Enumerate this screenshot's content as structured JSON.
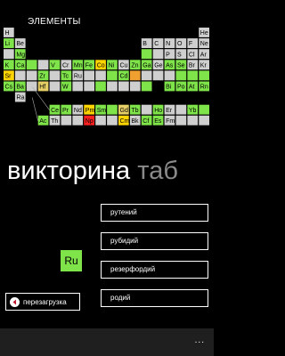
{
  "header": {
    "title": "ЭЛЕМЕНТЫ"
  },
  "colors": {
    "nonmetal": "#7fe34a",
    "metal": "#cfcfcf",
    "highlight": "#ffd400",
    "alkali": "#e6cf66",
    "selected": "#ff2020",
    "gold": "#f0a030"
  },
  "table": [
    {
      "sym": "H",
      "row": 0,
      "col": 0,
      "cat": "metal"
    },
    {
      "sym": "He",
      "row": 0,
      "col": 17,
      "cat": "metal"
    },
    {
      "sym": "Li",
      "row": 1,
      "col": 0,
      "cat": "nonmetal"
    },
    {
      "sym": "Be",
      "row": 1,
      "col": 1,
      "cat": "metal"
    },
    {
      "sym": "B",
      "row": 1,
      "col": 12,
      "cat": "metal"
    },
    {
      "sym": "C",
      "row": 1,
      "col": 13,
      "cat": "metal"
    },
    {
      "sym": "N",
      "row": 1,
      "col": 14,
      "cat": "metal"
    },
    {
      "sym": "O",
      "row": 1,
      "col": 15,
      "cat": "metal"
    },
    {
      "sym": "F",
      "row": 1,
      "col": 16,
      "cat": "metal"
    },
    {
      "sym": "Ne",
      "row": 1,
      "col": 17,
      "cat": "metal"
    },
    {
      "sym": "Mg",
      "row": 2,
      "col": 1,
      "cat": "nonmetal"
    },
    {
      "sym": "",
      "row": 2,
      "col": 0,
      "cat": "metal"
    },
    {
      "sym": "",
      "row": 2,
      "col": 12,
      "cat": "nonmetal"
    },
    {
      "sym": "",
      "row": 2,
      "col": 13,
      "cat": "metal"
    },
    {
      "sym": "P",
      "row": 2,
      "col": 14,
      "cat": "metal"
    },
    {
      "sym": "S",
      "row": 2,
      "col": 15,
      "cat": "metal"
    },
    {
      "sym": "Cl",
      "row": 2,
      "col": 16,
      "cat": "metal"
    },
    {
      "sym": "Ar",
      "row": 2,
      "col": 17,
      "cat": "metal"
    },
    {
      "sym": "K",
      "row": 3,
      "col": 0,
      "cat": "nonmetal"
    },
    {
      "sym": "Ca",
      "row": 3,
      "col": 1,
      "cat": "nonmetal"
    },
    {
      "sym": "",
      "row": 3,
      "col": 2,
      "cat": "nonmetal"
    },
    {
      "sym": "",
      "row": 3,
      "col": 3,
      "cat": "metal"
    },
    {
      "sym": "V",
      "row": 3,
      "col": 4,
      "cat": "nonmetal"
    },
    {
      "sym": "Cr",
      "row": 3,
      "col": 5,
      "cat": "metal"
    },
    {
      "sym": "Mn",
      "row": 3,
      "col": 6,
      "cat": "nonmetal"
    },
    {
      "sym": "Fe",
      "row": 3,
      "col": 7,
      "cat": "nonmetal"
    },
    {
      "sym": "Co",
      "row": 3,
      "col": 8,
      "cat": "highlight"
    },
    {
      "sym": "Ni",
      "row": 3,
      "col": 9,
      "cat": "nonmetal"
    },
    {
      "sym": "Cu",
      "row": 3,
      "col": 10,
      "cat": "metal"
    },
    {
      "sym": "Zn",
      "row": 3,
      "col": 11,
      "cat": "nonmetal"
    },
    {
      "sym": "Ga",
      "row": 3,
      "col": 12,
      "cat": "nonmetal"
    },
    {
      "sym": "Ge",
      "row": 3,
      "col": 13,
      "cat": "metal"
    },
    {
      "sym": "As",
      "row": 3,
      "col": 14,
      "cat": "nonmetal"
    },
    {
      "sym": "Se",
      "row": 3,
      "col": 15,
      "cat": "nonmetal"
    },
    {
      "sym": "Br",
      "row": 3,
      "col": 16,
      "cat": "metal"
    },
    {
      "sym": "Kr",
      "row": 3,
      "col": 17,
      "cat": "metal"
    },
    {
      "sym": "",
      "row": 4,
      "col": 0,
      "cat": "metal"
    },
    {
      "sym": "",
      "row": 4,
      "col": 1,
      "cat": "metal"
    },
    {
      "sym": "",
      "row": 4,
      "col": 2,
      "cat": "metal"
    },
    {
      "sym": "Zr",
      "row": 4,
      "col": 3,
      "cat": "nonmetal"
    },
    {
      "sym": "",
      "row": 4,
      "col": 4,
      "cat": "metal"
    },
    {
      "sym": "Tc",
      "row": 4,
      "col": 5,
      "cat": "nonmetal"
    },
    {
      "sym": "Ru",
      "row": 4,
      "col": 6,
      "cat": "metal"
    },
    {
      "sym": "",
      "row": 4,
      "col": 7,
      "cat": "metal"
    },
    {
      "sym": "",
      "row": 4,
      "col": 8,
      "cat": "metal"
    },
    {
      "sym": "",
      "row": 4,
      "col": 9,
      "cat": "nonmetal"
    },
    {
      "sym": "Cd",
      "row": 4,
      "col": 10,
      "cat": "nonmetal"
    },
    {
      "sym": "",
      "row": 4,
      "col": 11,
      "cat": "gold"
    },
    {
      "sym": "",
      "row": 4,
      "col": 12,
      "cat": "metal"
    },
    {
      "sym": "",
      "row": 4,
      "col": 13,
      "cat": "metal"
    },
    {
      "sym": "",
      "row": 4,
      "col": 14,
      "cat": "metal"
    },
    {
      "sym": "",
      "row": 4,
      "col": 15,
      "cat": "nonmetal"
    },
    {
      "sym": "",
      "row": 4,
      "col": 16,
      "cat": "nonmetal"
    },
    {
      "sym": "",
      "row": 4,
      "col": 17,
      "cat": "nonmetal"
    },
    {
      "sym": "Cs",
      "row": 5,
      "col": 0,
      "cat": "nonmetal"
    },
    {
      "sym": "Ba",
      "row": 5,
      "col": 1,
      "cat": "nonmetal"
    },
    {
      "sym": "",
      "row": 5,
      "col": 2,
      "cat": "metal"
    },
    {
      "sym": "Hf",
      "row": 5,
      "col": 3,
      "cat": "alkali"
    },
    {
      "sym": "",
      "row": 5,
      "col": 4,
      "cat": "metal"
    },
    {
      "sym": "W",
      "row": 5,
      "col": 5,
      "cat": "nonmetal"
    },
    {
      "sym": "",
      "row": 5,
      "col": 6,
      "cat": "metal"
    },
    {
      "sym": "",
      "row": 5,
      "col": 7,
      "cat": "metal"
    },
    {
      "sym": "",
      "row": 5,
      "col": 8,
      "cat": "nonmetal"
    },
    {
      "sym": "",
      "row": 5,
      "col": 9,
      "cat": "metal"
    },
    {
      "sym": "",
      "row": 5,
      "col": 10,
      "cat": "metal"
    },
    {
      "sym": "",
      "row": 5,
      "col": 11,
      "cat": "metal"
    },
    {
      "sym": "",
      "row": 5,
      "col": 12,
      "cat": "nonmetal"
    },
    {
      "sym": "Bi",
      "row": 5,
      "col": 14,
      "cat": "nonmetal"
    },
    {
      "sym": "Po",
      "row": 5,
      "col": 15,
      "cat": "nonmetal"
    },
    {
      "sym": "At",
      "row": 5,
      "col": 16,
      "cat": "nonmetal"
    },
    {
      "sym": "Rn",
      "row": 5,
      "col": 17,
      "cat": "nonmetal"
    },
    {
      "sym": "Ra",
      "row": 6,
      "col": 1,
      "cat": "metal"
    },
    {
      "sym": "Sr",
      "row": 4,
      "col": 0,
      "cat": "highlight"
    },
    {
      "sym": "Ce",
      "row": 8,
      "col": 4,
      "cat": "nonmetal"
    },
    {
      "sym": "Pr",
      "row": 8,
      "col": 5,
      "cat": "nonmetal"
    },
    {
      "sym": "Nd",
      "row": 8,
      "col": 6,
      "cat": "metal"
    },
    {
      "sym": "Pm",
      "row": 8,
      "col": 7,
      "cat": "highlight"
    },
    {
      "sym": "Sm",
      "row": 8,
      "col": 8,
      "cat": "nonmetal"
    },
    {
      "sym": "",
      "row": 8,
      "col": 9,
      "cat": "nonmetal"
    },
    {
      "sym": "Gd",
      "row": 8,
      "col": 10,
      "cat": "alkali"
    },
    {
      "sym": "Tb",
      "row": 8,
      "col": 11,
      "cat": "nonmetal"
    },
    {
      "sym": "",
      "row": 8,
      "col": 12,
      "cat": "metal"
    },
    {
      "sym": "Ho",
      "row": 8,
      "col": 13,
      "cat": "nonmetal"
    },
    {
      "sym": "Er",
      "row": 8,
      "col": 14,
      "cat": "metal"
    },
    {
      "sym": "",
      "row": 8,
      "col": 15,
      "cat": "metal"
    },
    {
      "sym": "Yb",
      "row": 8,
      "col": 16,
      "cat": "nonmetal"
    },
    {
      "sym": "",
      "row": 8,
      "col": 17,
      "cat": "nonmetal"
    },
    {
      "sym": "Ac",
      "row": 9,
      "col": 3,
      "cat": "nonmetal"
    },
    {
      "sym": "Th",
      "row": 9,
      "col": 4,
      "cat": "metal"
    },
    {
      "sym": "",
      "row": 9,
      "col": 5,
      "cat": "metal"
    },
    {
      "sym": "",
      "row": 9,
      "col": 6,
      "cat": "metal"
    },
    {
      "sym": "Np",
      "row": 9,
      "col": 7,
      "cat": "selected"
    },
    {
      "sym": "",
      "row": 9,
      "col": 8,
      "cat": "metal"
    },
    {
      "sym": "",
      "row": 9,
      "col": 9,
      "cat": "metal"
    },
    {
      "sym": "Cm",
      "row": 9,
      "col": 10,
      "cat": "highlight"
    },
    {
      "sym": "Bk",
      "row": 9,
      "col": 11,
      "cat": "metal"
    },
    {
      "sym": "Cf",
      "row": 9,
      "col": 12,
      "cat": "nonmetal"
    },
    {
      "sym": "Es",
      "row": 9,
      "col": 13,
      "cat": "nonmetal"
    },
    {
      "sym": "Fm",
      "row": 9,
      "col": 14,
      "cat": "metal"
    },
    {
      "sym": "",
      "row": 9,
      "col": 15,
      "cat": "metal"
    },
    {
      "sym": "",
      "row": 9,
      "col": 16,
      "cat": "metal"
    },
    {
      "sym": "",
      "row": 9,
      "col": 17,
      "cat": "metal"
    }
  ],
  "quiz": {
    "title_main": "викторина",
    "title_dim": "таб"
  },
  "question": {
    "symbol": "Ru"
  },
  "answers": [
    "рутений",
    "рубидий",
    "резерфордий",
    "родий"
  ],
  "reload": {
    "label": "перезагрузка",
    "icon": "back-arrow-icon"
  },
  "appbar": {
    "more": "..."
  }
}
